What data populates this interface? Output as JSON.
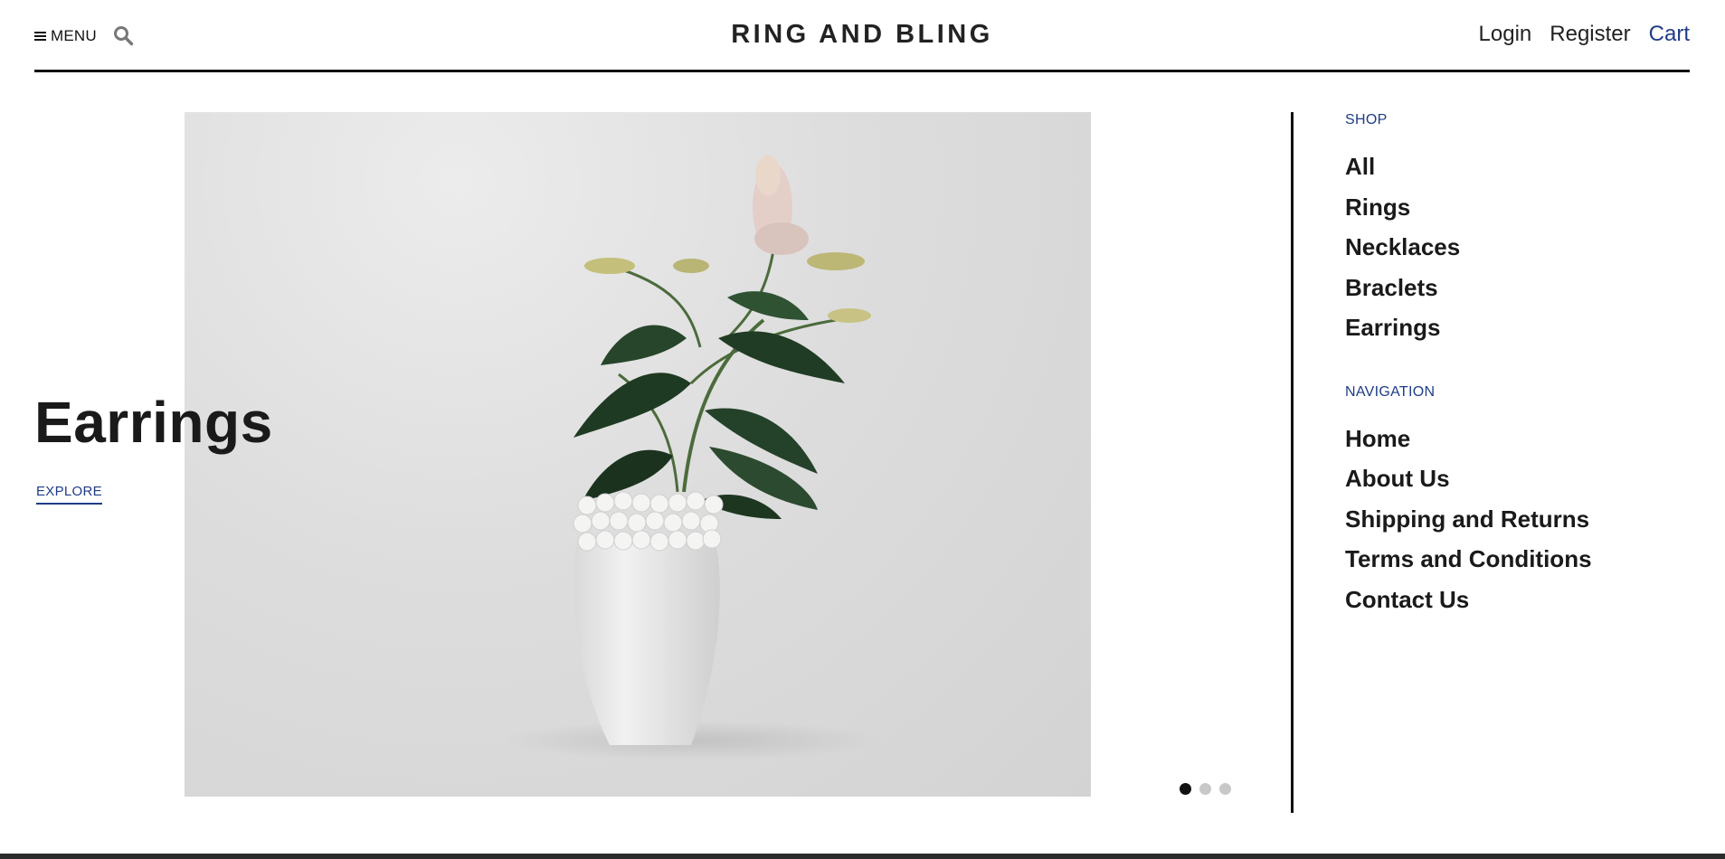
{
  "header": {
    "menu_label": "MENU",
    "menu_icon": "hamburger-icon",
    "search_icon": "search-icon",
    "brand": "RING AND BLING",
    "login": "Login",
    "register": "Register",
    "cart": "Cart"
  },
  "hero": {
    "title": "Earrings",
    "explore": "EXPLORE",
    "image": "white-vase-with-flowers-and-pearl-bracelets",
    "slides": [
      {
        "active": true
      },
      {
        "active": false
      },
      {
        "active": false
      }
    ]
  },
  "sidebar": {
    "shop_heading": "SHOP",
    "shop_items": [
      "All",
      "Rings",
      "Necklaces",
      "Braclets",
      "Earrings"
    ],
    "nav_heading": "NAVIGATION",
    "nav_items": [
      "Home",
      "About Us",
      "Shipping and Returns",
      "Terms and Conditions",
      "Contact Us"
    ]
  },
  "colors": {
    "accent": "#1f3c88",
    "text": "#1a1a1a",
    "dot_inactive": "#c8c8c8",
    "dot_active": "#111111"
  }
}
